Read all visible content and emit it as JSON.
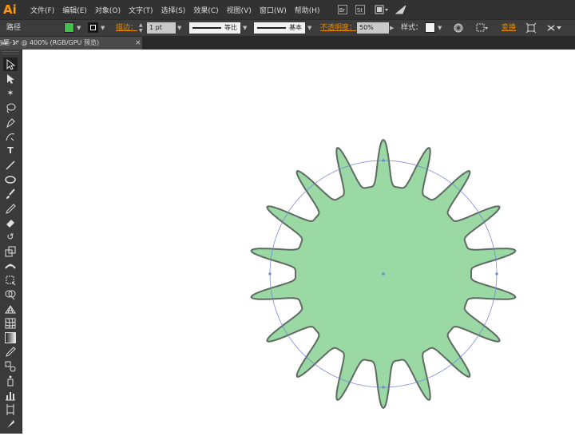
{
  "app": {
    "logo": "Ai"
  },
  "menu": [
    "文件(F)",
    "编辑(E)",
    "对象(O)",
    "文字(T)",
    "选择(S)",
    "效果(C)",
    "视图(V)",
    "窗口(W)",
    "帮助(H)"
  ],
  "menubar_icons": {
    "bridge": "Br",
    "stock": "St"
  },
  "control": {
    "selection_label": "路径",
    "fill_color": "#3fbf4c",
    "stroke_label": "描边：",
    "stroke_weight": "1 pt",
    "profile_label": "等比",
    "brush_label": "基本",
    "opacity_label": "不透明度：",
    "opacity_value": "50%",
    "style_label": "样式：",
    "transform_label": "变换"
  },
  "document": {
    "tab_title": "未标题-1* @ 400% (RGB/GPU 预览)",
    "close_glyph": "×"
  },
  "canvas": {
    "shape_fill": "#9ad8a4",
    "shape_stroke": "#5f6b62",
    "guide_color": "#6b7fd6"
  },
  "tools": [
    "selection-tool",
    "direct-selection-tool",
    "magic-wand-tool",
    "lasso-tool",
    "pen-tool",
    "curvature-tool",
    "type-tool",
    "line-tool",
    "ellipse-tool",
    "paintbrush-tool",
    "pencil-tool",
    "eraser-tool",
    "rotate-tool",
    "scale-tool",
    "width-tool",
    "free-transform-tool",
    "shape-builder-tool",
    "perspective-grid-tool",
    "mesh-tool",
    "gradient-tool",
    "eyedropper-tool",
    "blend-tool",
    "symbol-sprayer-tool",
    "column-graph-tool",
    "artboard-tool",
    "slice-tool"
  ]
}
